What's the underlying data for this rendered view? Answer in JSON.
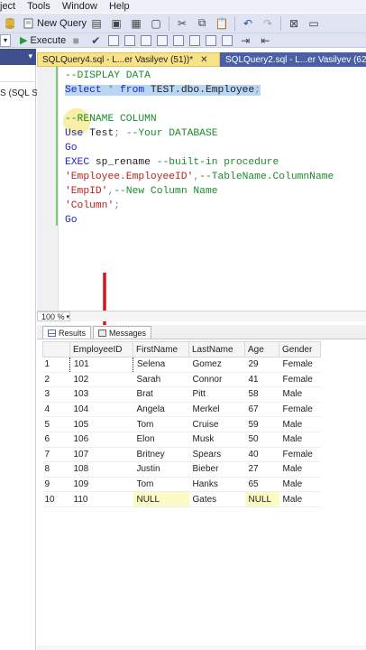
{
  "menu": [
    "ject",
    "Tools",
    "Window",
    "Help"
  ],
  "toolbar1": {
    "new_query_label": "New Query"
  },
  "toolbar2": {
    "execute_label": "Execute"
  },
  "left_pane": {
    "partial_text": "S (SQL S"
  },
  "tabs": [
    {
      "label": "SQLQuery4.sql - L...er Vasilyev (51))*",
      "active": true,
      "close": "✕"
    },
    {
      "label": "SQLQuery2.sql - L...er Vasilyev (62",
      "active": false
    }
  ],
  "editor": {
    "lines": [
      {
        "parts": [
          {
            "t": "--DISPLAY DATA",
            "c": "cm"
          }
        ]
      },
      {
        "parts": [
          {
            "t": "Select",
            "c": "kw sel"
          },
          {
            "t": " * ",
            "c": "gr sel"
          },
          {
            "t": "from",
            "c": "kw sel"
          },
          {
            "t": " TEST.dbo.Employee",
            "c": "sel"
          },
          {
            "t": ";",
            "c": "gr sel"
          }
        ]
      },
      {
        "parts": [
          {
            "t": "",
            "c": ""
          }
        ]
      },
      {
        "parts": [
          {
            "t": "--RENAME COLUMN",
            "c": "cm"
          }
        ]
      },
      {
        "parts": [
          {
            "t": "Use",
            "c": "kw"
          },
          {
            "t": " Test",
            "c": ""
          },
          {
            "t": ";",
            "c": "gr"
          },
          {
            "t": " --Your DATABASE",
            "c": "cm"
          }
        ]
      },
      {
        "parts": [
          {
            "t": "Go",
            "c": "kw"
          }
        ]
      },
      {
        "parts": [
          {
            "t": "EXEC",
            "c": "kw"
          },
          {
            "t": " sp_rename ",
            "c": ""
          },
          {
            "t": "--built-in procedure",
            "c": "cm"
          }
        ]
      },
      {
        "parts": [
          {
            "t": "'Employee.EmployeeID'",
            "c": "st"
          },
          {
            "t": ",",
            "c": "gr"
          },
          {
            "t": "--TableName.ColumnName",
            "c": "cm"
          }
        ]
      },
      {
        "parts": [
          {
            "t": "'EmpID'",
            "c": "st"
          },
          {
            "t": ",",
            "c": "gr"
          },
          {
            "t": "--New Column Name",
            "c": "cm"
          }
        ]
      },
      {
        "parts": [
          {
            "t": "'Column'",
            "c": "st"
          },
          {
            "t": ";",
            "c": "gr"
          }
        ]
      },
      {
        "parts": [
          {
            "t": "Go",
            "c": "kw"
          }
        ]
      }
    ]
  },
  "zoom": {
    "value": "100 %"
  },
  "result_tabs": {
    "results_label": "Results",
    "messages_label": "Messages"
  },
  "grid": {
    "columns": [
      "EmployeeID",
      "FirstName",
      "LastName",
      "Age",
      "Gender"
    ],
    "rows": [
      [
        "1",
        "101",
        "Selena",
        "Gomez",
        "29",
        "Female"
      ],
      [
        "2",
        "102",
        "Sarah",
        "Connor",
        "41",
        "Female"
      ],
      [
        "3",
        "103",
        "Brat",
        "Pitt",
        "58",
        "Male"
      ],
      [
        "4",
        "104",
        "Angela",
        "Merkel",
        "67",
        "Female"
      ],
      [
        "5",
        "105",
        "Tom",
        "Cruise",
        "59",
        "Male"
      ],
      [
        "6",
        "106",
        "Elon",
        "Musk",
        "50",
        "Male"
      ],
      [
        "7",
        "107",
        "Britney",
        "Spears",
        "40",
        "Female"
      ],
      [
        "8",
        "108",
        "Justin",
        "Bieber",
        "27",
        "Male"
      ],
      [
        "9",
        "109",
        "Tom",
        "Hanks",
        "65",
        "Male"
      ],
      [
        "10",
        "110",
        "NULL",
        "Gates",
        "NULL",
        "Male"
      ]
    ]
  },
  "colors": {
    "accent": "#3f4e8c",
    "active_tab": "#f7e28a",
    "arrow": "#d8141e"
  }
}
